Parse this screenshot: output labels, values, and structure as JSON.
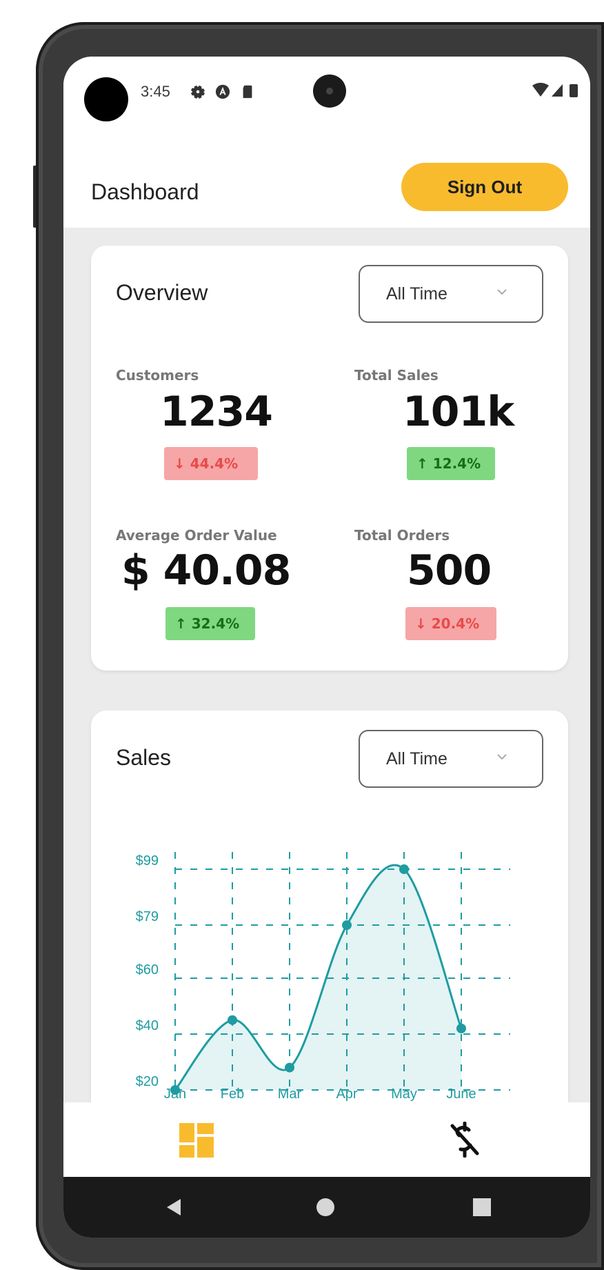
{
  "status_bar": {
    "time": "3:45"
  },
  "app_bar": {
    "title": "Dashboard",
    "sign_out_label": "Sign Out",
    "accent": "#f9bb2e"
  },
  "overview": {
    "title": "Overview",
    "filter": "All Time",
    "stats": [
      {
        "label": "Customers",
        "value": "1234",
        "change": "44.4%",
        "direction": "down"
      },
      {
        "label": "Total Sales",
        "value": "101k",
        "change": "12.4%",
        "direction": "up"
      },
      {
        "label": "Average Order Value",
        "value": "$ 40.08",
        "change": "32.4%",
        "direction": "up"
      },
      {
        "label": "Total Orders",
        "value": "500",
        "change": "20.4%",
        "direction": "down"
      }
    ]
  },
  "sales": {
    "title": "Sales",
    "filter": "All Time",
    "color": "#1e9ca1"
  },
  "chart_data": {
    "type": "area",
    "categories": [
      "Jan",
      "Feb",
      "Mar",
      "Apr",
      "May",
      "June"
    ],
    "values": [
      20,
      45,
      28,
      79,
      99,
      42
    ],
    "y_ticks": [
      "$20",
      "$40",
      "$60",
      "$79",
      "$99"
    ],
    "y_tick_values": [
      20,
      40,
      60,
      79,
      99
    ],
    "ylim": [
      20,
      99
    ],
    "grid": true,
    "curve": "smooth"
  },
  "bottom_nav": {
    "items": [
      {
        "icon": "dashboard-icon",
        "active": true
      },
      {
        "icon": "money-off-icon",
        "active": false
      }
    ]
  },
  "system_nav": {
    "items": [
      "back-icon",
      "home-icon",
      "recents-icon"
    ]
  }
}
